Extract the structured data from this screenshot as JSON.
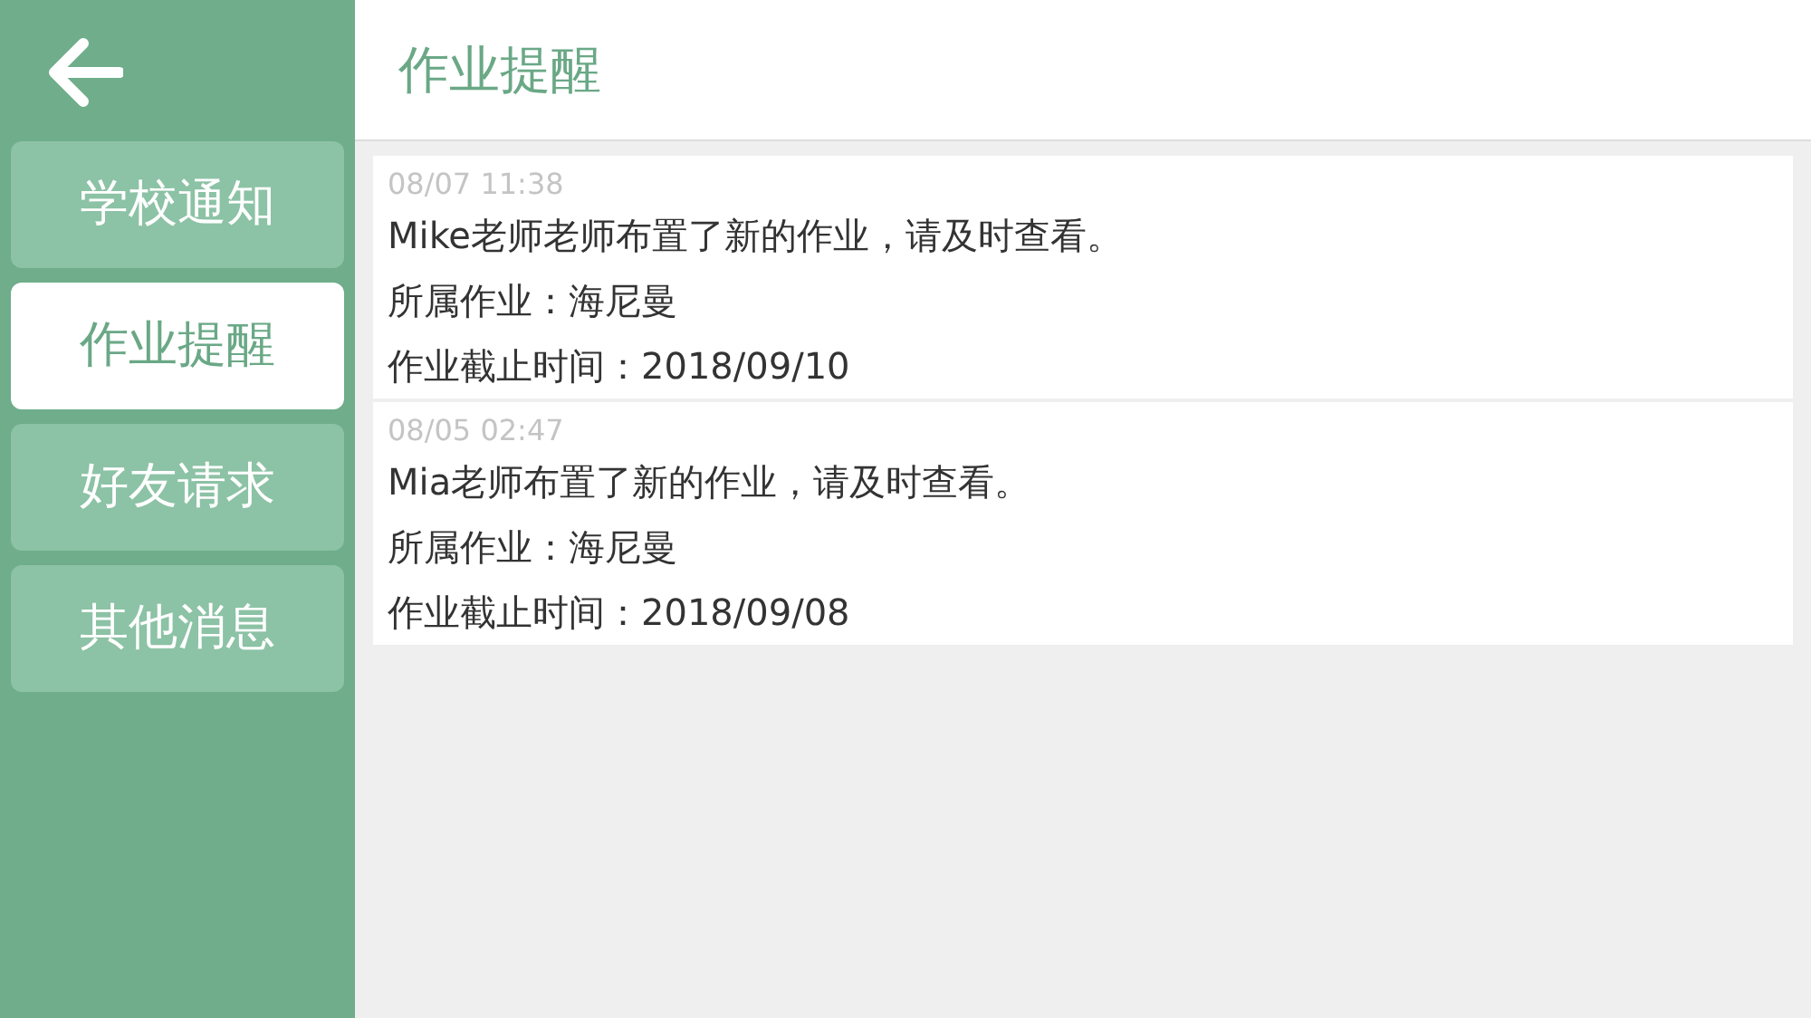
{
  "header": {
    "title": "作业提醒"
  },
  "sidebar": {
    "items": [
      {
        "label": "学校通知",
        "selected": false
      },
      {
        "label": "作业提醒",
        "selected": true
      },
      {
        "label": "好友请求",
        "selected": false
      },
      {
        "label": "其他消息",
        "selected": false
      }
    ]
  },
  "messages": [
    {
      "time": "08/07  11:38",
      "text": "Mike老师老师布置了新的作业，请及时查看。",
      "homework": "所属作业：海尼曼",
      "deadline": "作业截止时间：2018/09/10"
    },
    {
      "time": "08/05  02:47",
      "text": "Mia老师布置了新的作业，请及时查看。",
      "homework": "所属作业：海尼曼",
      "deadline": "作业截止时间：2018/09/08"
    }
  ]
}
